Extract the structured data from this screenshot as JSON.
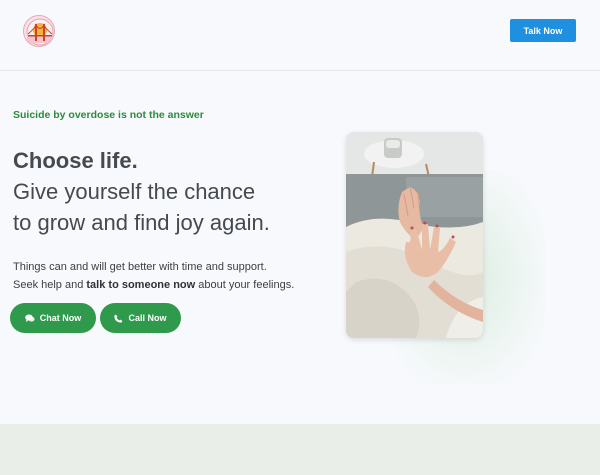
{
  "header": {
    "logo_icon": "golden-gate-bridge-logo",
    "talk_button_label": "Talk Now"
  },
  "hero": {
    "tagline": "Suicide by overdose is not the answer",
    "headline_strong": "Choose life.",
    "headline_line2": "Give yourself the chance",
    "headline_line3": "to grow and find joy again.",
    "body_line1": "Things can and will get better with time and support.",
    "body_line2_prefix": "Seek help and ",
    "body_line2_bold": "talk to someone now",
    "body_line2_suffix": " about your feelings.",
    "chat_button_label": "Chat Now",
    "chat_button_icon": "chat-bubbles-icon",
    "call_button_label": "Call Now",
    "call_button_icon": "phone-icon",
    "photo_description": "two hands reaching toward each other"
  },
  "colors": {
    "accent_blue": "#1f8fdf",
    "accent_green": "#2f9a4c",
    "tagline_green": "#2d8a3e",
    "footer_band": "#e9efe8"
  }
}
